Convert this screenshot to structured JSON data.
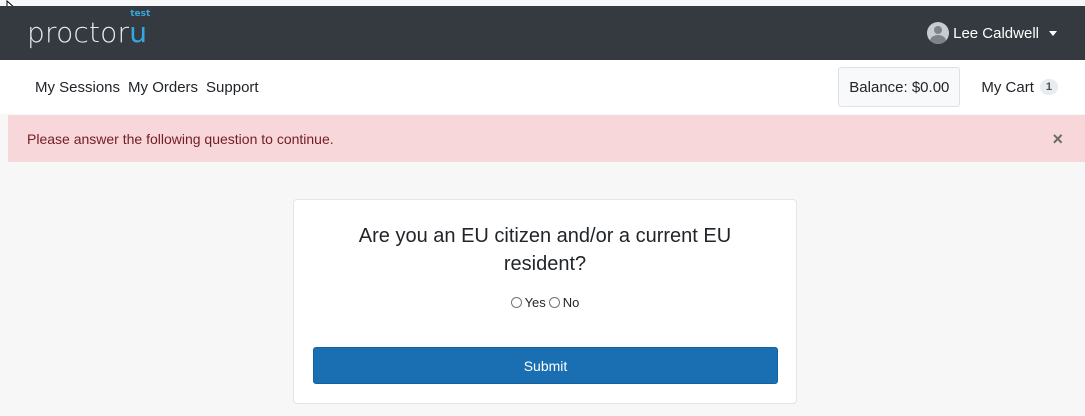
{
  "brand": {
    "text": "proctor",
    "accent": "u",
    "superscript": "test"
  },
  "user": {
    "name": "Lee Caldwell",
    "avatar_icon": "user-avatar-icon"
  },
  "nav": {
    "links": [
      "My Sessions",
      "My Orders",
      "Support"
    ],
    "balance": "Balance: $0.00",
    "cart_label": "My Cart",
    "cart_count": "1"
  },
  "alert": {
    "message": "Please answer the following question to continue.",
    "close": "×"
  },
  "form": {
    "question": "Are you an EU citizen and/or a current EU resident?",
    "options": [
      "Yes",
      "No"
    ],
    "submit_label": "Submit"
  },
  "colors": {
    "navbar": "#343a40",
    "brand_accent": "#35a7e0",
    "alert_bg": "#f8d7da",
    "submit_bg": "#1a6fb3"
  }
}
